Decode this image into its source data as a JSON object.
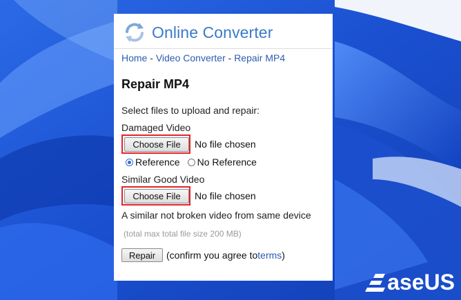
{
  "brand": {
    "name": "Online Converter"
  },
  "breadcrumb": {
    "home": "Home",
    "sep1": " - ",
    "video_converter": "Video Converter",
    "sep2": " - ",
    "current": "Repair MP4"
  },
  "page": {
    "title": "Repair MP4",
    "instructions": "Select files to upload and repair:"
  },
  "damaged": {
    "label": "Damaged Video",
    "button_label": "Choose File",
    "status": "No file chosen"
  },
  "mode": {
    "options": [
      {
        "label": "Reference",
        "checked": true
      },
      {
        "label": "No Reference",
        "checked": false
      }
    ]
  },
  "similar": {
    "label": "Similar Good Video",
    "button_label": "Choose File",
    "status": "No file chosen",
    "hint": "A similar not broken video from same device"
  },
  "limits": {
    "note": "(total max total file size 200 MB)"
  },
  "actions": {
    "repair_label": "Repair",
    "confirm_prefix": "(confirm you agree to ",
    "terms_link": "terms",
    "confirm_suffix": ")"
  },
  "watermark": {
    "text": "aseUS"
  },
  "colors": {
    "link": "#2a5db0",
    "brand": "#3a7ac9",
    "highlight": "#e0242b",
    "wallpaper": "#1d57d6"
  }
}
